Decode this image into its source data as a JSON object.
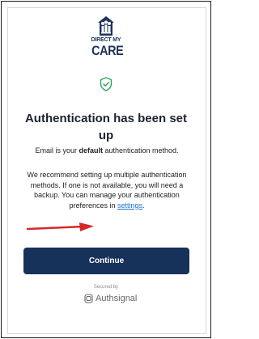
{
  "logo": {
    "line1": "DIRECT MY",
    "line2": "CARE"
  },
  "title": "Authentication has been set up",
  "email": {
    "pre": "Email is your ",
    "bold": "default",
    "post": " authentication method."
  },
  "recommend": {
    "text": "We recommend setting up multiple authentication methods. If one is not available, you will need a backup. You can manage your authentication preferences in ",
    "link": "settings",
    "end": "."
  },
  "button": {
    "label": "Continue"
  },
  "footer": {
    "secured_by": "Secured by",
    "brand": "Authsignal"
  },
  "colors": {
    "navy": "#17325a",
    "link": "#1d6fd1",
    "shield": "#2aa05a",
    "arrow": "#d62828"
  },
  "icons": {
    "logo": "family-house-logo-icon",
    "shield": "shield-check-icon",
    "brand": "authsignal-logo-icon",
    "annotation": "red-arrow-icon"
  }
}
